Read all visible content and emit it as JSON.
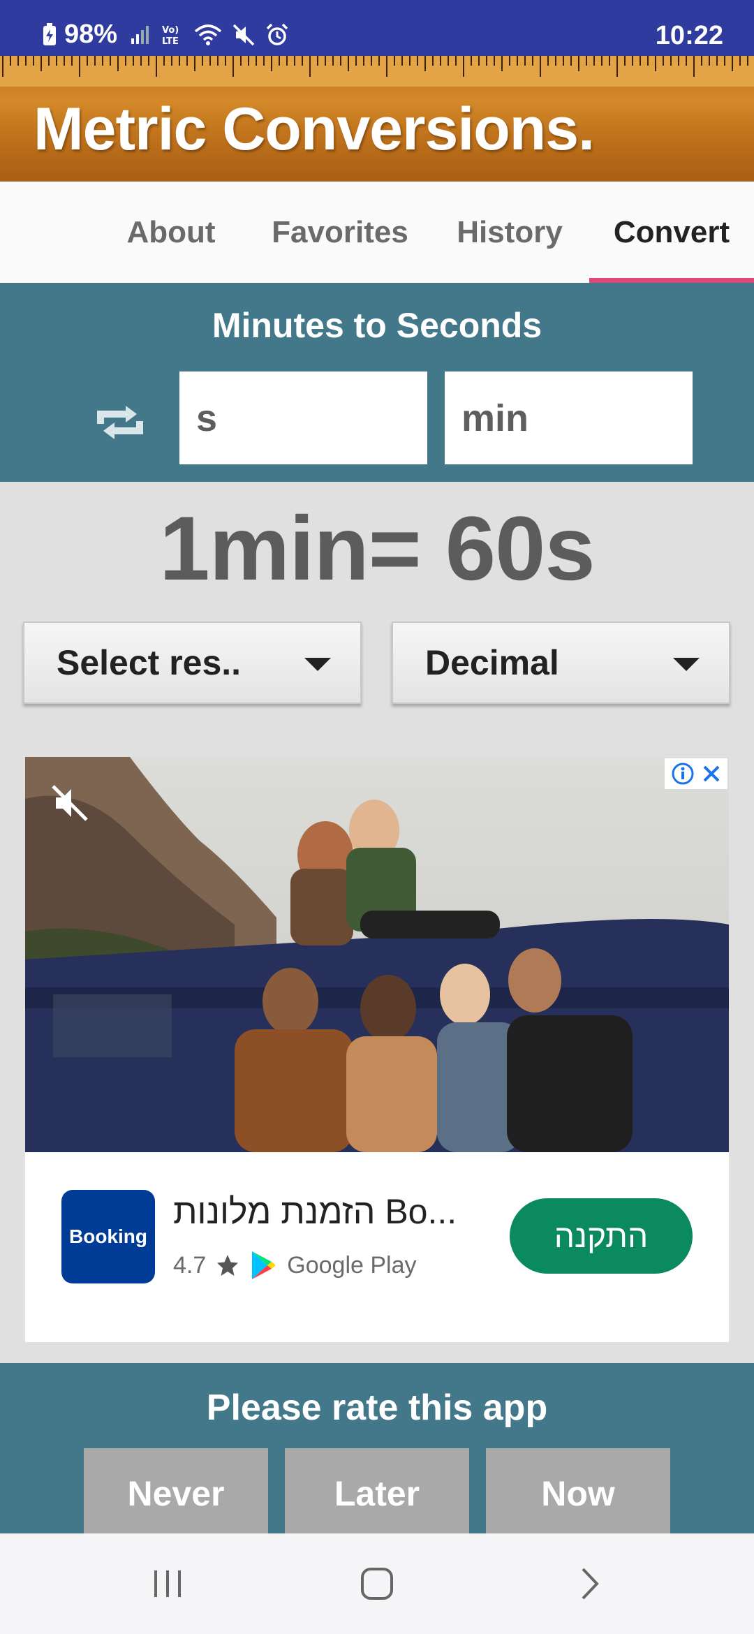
{
  "status_bar": {
    "battery": "98%",
    "time": "10:22",
    "icons": [
      "battery-charging-icon",
      "signal-icon",
      "volte-icon",
      "wifi-icon",
      "mute-icon",
      "alarm-icon"
    ]
  },
  "header": {
    "title": "Metric Conversions."
  },
  "tabs": [
    {
      "label": "About"
    },
    {
      "label": "Favorites"
    },
    {
      "label": "History"
    },
    {
      "label": "Convert",
      "active": true
    }
  ],
  "converter": {
    "title": "Minutes to Seconds",
    "from_unit": "s",
    "to_unit": "min",
    "swap_icon": "swap-icon"
  },
  "result": {
    "text": "1min= 60s"
  },
  "dropdowns": {
    "result_select": "Select res..",
    "format_select": "Decimal"
  },
  "ad": {
    "advertiser_logo_text": "Booking",
    "headline": "הזמנת מלונות Bo...",
    "rating": "4.7",
    "store": "Google Play",
    "install_label": "התקנה"
  },
  "rate": {
    "title": "Please rate this app",
    "buttons": [
      "Never",
      "Later",
      "Now"
    ]
  },
  "colors": {
    "status_bar": "#2f3b9e",
    "panel": "#42788a",
    "tab_indicator": "#e0487a",
    "install_button": "#0b8a5f",
    "booking_blue": "#003b95"
  }
}
